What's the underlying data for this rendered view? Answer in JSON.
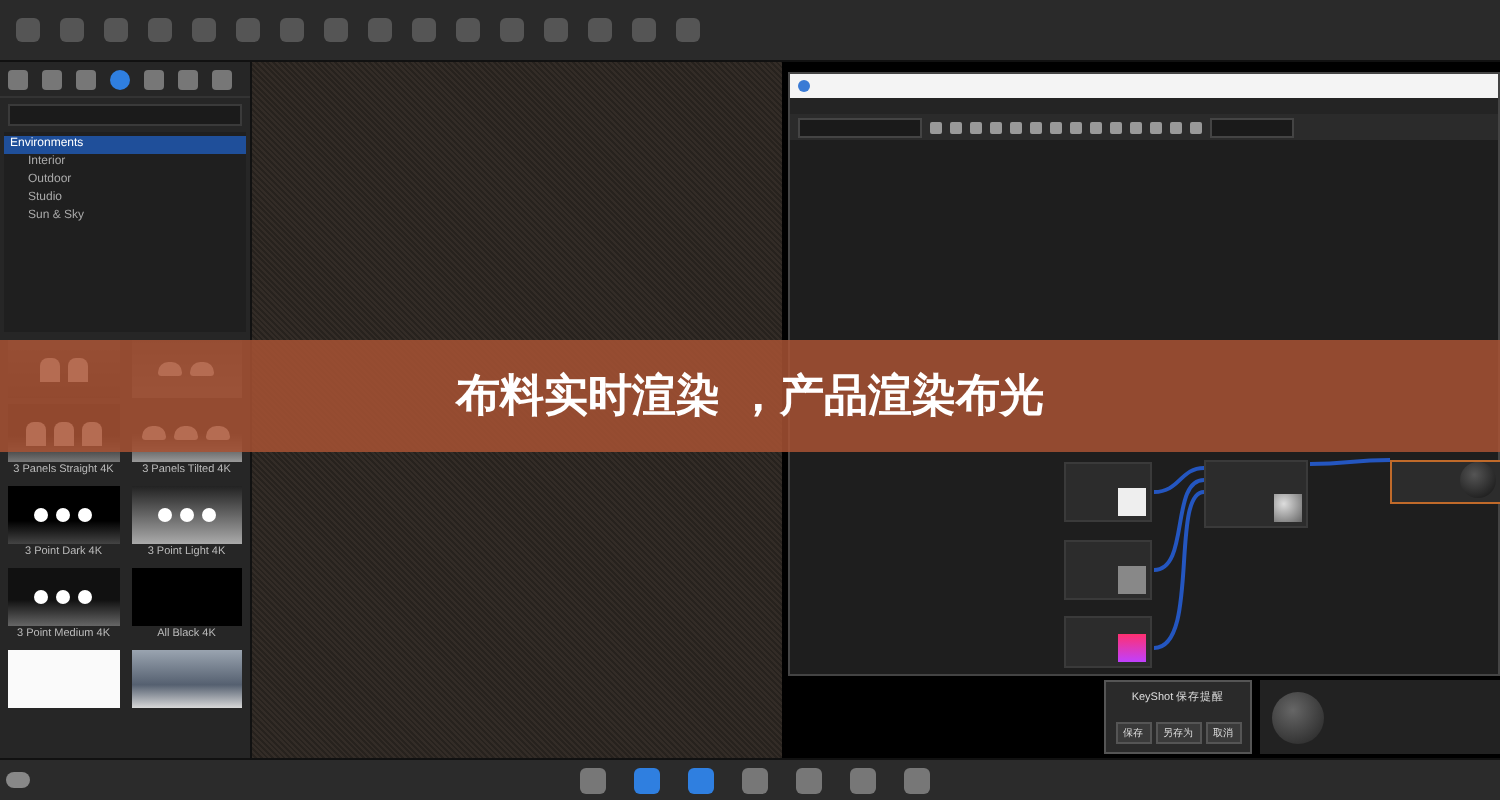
{
  "banner": {
    "title": "布料实时渲染 ，产品渲染布光"
  },
  "library": {
    "tree": [
      {
        "label": "Environments",
        "selected": true,
        "children": [
          {
            "label": "Interior",
            "selected": false
          },
          {
            "label": "Outdoor",
            "selected": false
          },
          {
            "label": "Studio",
            "selected": false
          },
          {
            "label": "Sun & Sky",
            "selected": false
          }
        ]
      }
    ],
    "thumbnails": [
      {
        "kind": "panels2"
      },
      {
        "kind": "panels2tilt"
      },
      {
        "label": "3 Panels Straight 4K",
        "kind": "panels3"
      },
      {
        "label": "3 Panels Tilted 4K",
        "kind": "panels3tilt"
      },
      {
        "label": "3 Point Dark 4K",
        "kind": "pointdark"
      },
      {
        "label": "3 Point Light 4K",
        "kind": "pointlight"
      },
      {
        "label": "3 Point Medium 4K",
        "kind": "pointmedium"
      },
      {
        "label": "All Black 4K",
        "kind": "black"
      },
      {
        "kind": "white"
      },
      {
        "kind": "room"
      }
    ]
  },
  "save_dialog": {
    "title": "KeyShot 保存提醒",
    "buttons": [
      "保存",
      "另存为",
      "取消"
    ]
  }
}
